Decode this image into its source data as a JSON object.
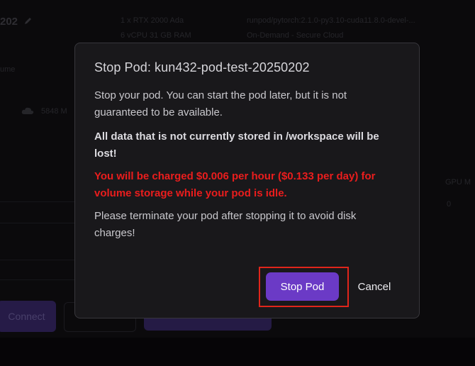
{
  "background": {
    "pod_title_suffix": "202",
    "gpu_line1": "1 x RTX 2000 Ada",
    "gpu_line2": "6 vCPU 31 GB RAM",
    "image_line1": "runpod/pytorch:2.1.0-py3.10-cuda11.8.0-devel-...",
    "image_line2": "On-Demand - Secure Cloud",
    "volume_fragment": "ume",
    "disk_label": "5848 M",
    "gpu_mem_label": "GPU M",
    "gpu_mem_value": "0",
    "connect_label": "Connect"
  },
  "modal": {
    "title": "Stop Pod: kun432-pod-test-20250202",
    "paragraph1": "Stop your pod. You can start the pod later, but it is not guaranteed to be available.",
    "paragraph2": "All data that is not currently stored in /workspace will be lost!",
    "paragraph3": "You will be charged $0.006 per hour ($0.133 per day) for volume storage while your pod is idle.",
    "paragraph4": "Please terminate your pod after stopping it to avoid disk charges!",
    "stop_button": "Stop Pod",
    "cancel_button": "Cancel"
  },
  "colors": {
    "accent": "#6b3ac6",
    "warning": "#ea1d1d",
    "highlight": "#e0251b",
    "modal_bg": "#19181b"
  }
}
